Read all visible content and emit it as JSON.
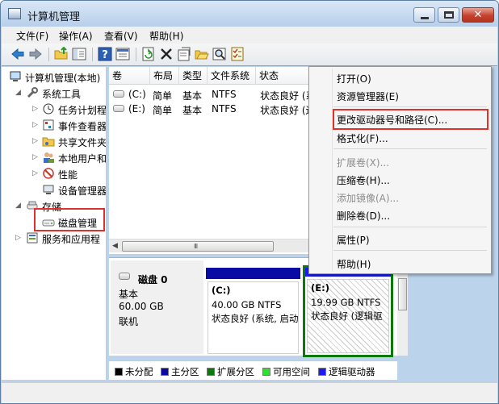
{
  "window": {
    "title": "计算机管理"
  },
  "menu": [
    "文件(F)",
    "操作(A)",
    "查看(V)",
    "帮助(H)"
  ],
  "toolbar": {
    "icons": [
      "back-arrow-icon",
      "forward-arrow-icon",
      "up-folder-icon",
      "show-tree-icon",
      "help-icon",
      "console-icon",
      "refresh-icon",
      "delete-icon",
      "properties-icon",
      "open-folder-icon",
      "search-icon",
      "checklist-icon"
    ]
  },
  "tree": {
    "items": [
      {
        "label": "计算机管理(本地)",
        "icon": "computer-icon"
      },
      {
        "label": "系统工具",
        "icon": "tools-icon"
      },
      {
        "label": "任务计划程",
        "icon": "clock-icon"
      },
      {
        "label": "事件查看器",
        "icon": "event-log-icon"
      },
      {
        "label": "共享文件夹",
        "icon": "shared-folder-icon"
      },
      {
        "label": "本地用户和",
        "icon": "users-icon"
      },
      {
        "label": "性能",
        "icon": "performance-icon"
      },
      {
        "label": "设备管理器",
        "icon": "device-manager-icon"
      },
      {
        "label": "存储",
        "icon": "storage-icon"
      },
      {
        "label": "磁盘管理",
        "icon": "disk-management-icon"
      },
      {
        "label": "服务和应用程",
        "icon": "services-icon"
      }
    ]
  },
  "volumes": {
    "columns": [
      "卷",
      "布局",
      "类型",
      "文件系统",
      "状态"
    ],
    "rows": [
      {
        "volume": "(C:)",
        "layout": "简单",
        "type": "基本",
        "fs": "NTFS",
        "status": "状态良好 (系"
      },
      {
        "volume": "(E:)",
        "layout": "简单",
        "type": "基本",
        "fs": "NTFS",
        "status": "状态良好 (逻"
      }
    ],
    "scroll_grip": "III"
  },
  "disk": {
    "name": "磁盘 0",
    "type": "基本",
    "size": "60.00 GB",
    "status": "联机",
    "partitions": [
      {
        "label": "(C:)",
        "size": "40.00 GB NTFS",
        "status": "状态良好 (系统, 启动"
      },
      {
        "label": "(E:)",
        "size": "19.99 GB NTFS",
        "status": "状态良好 (逻辑驱"
      }
    ]
  },
  "legend": [
    {
      "label": "未分配",
      "color": "#000000"
    },
    {
      "label": "主分区",
      "color": "#0a0aa4"
    },
    {
      "label": "扩展分区",
      "color": "#0a7a0a"
    },
    {
      "label": "可用空间",
      "color": "#30e030"
    },
    {
      "label": "逻辑驱动器",
      "color": "#1c1cf0"
    }
  ],
  "context_menu": {
    "open": "打开(O)",
    "explorer": "资源管理器(E)",
    "change_letter": "更改驱动器号和路径(C)...",
    "format": "格式化(F)...",
    "extend": "扩展卷(X)...",
    "shrink": "压缩卷(H)...",
    "add_mirror": "添加镜像(A)...",
    "delete": "删除卷(D)...",
    "properties": "属性(P)",
    "help": "帮助(H)"
  },
  "colors": {
    "highlight": "#e0322d",
    "primary_partition": "#0a0aa4",
    "extended_partition": "#0a7a0a"
  }
}
